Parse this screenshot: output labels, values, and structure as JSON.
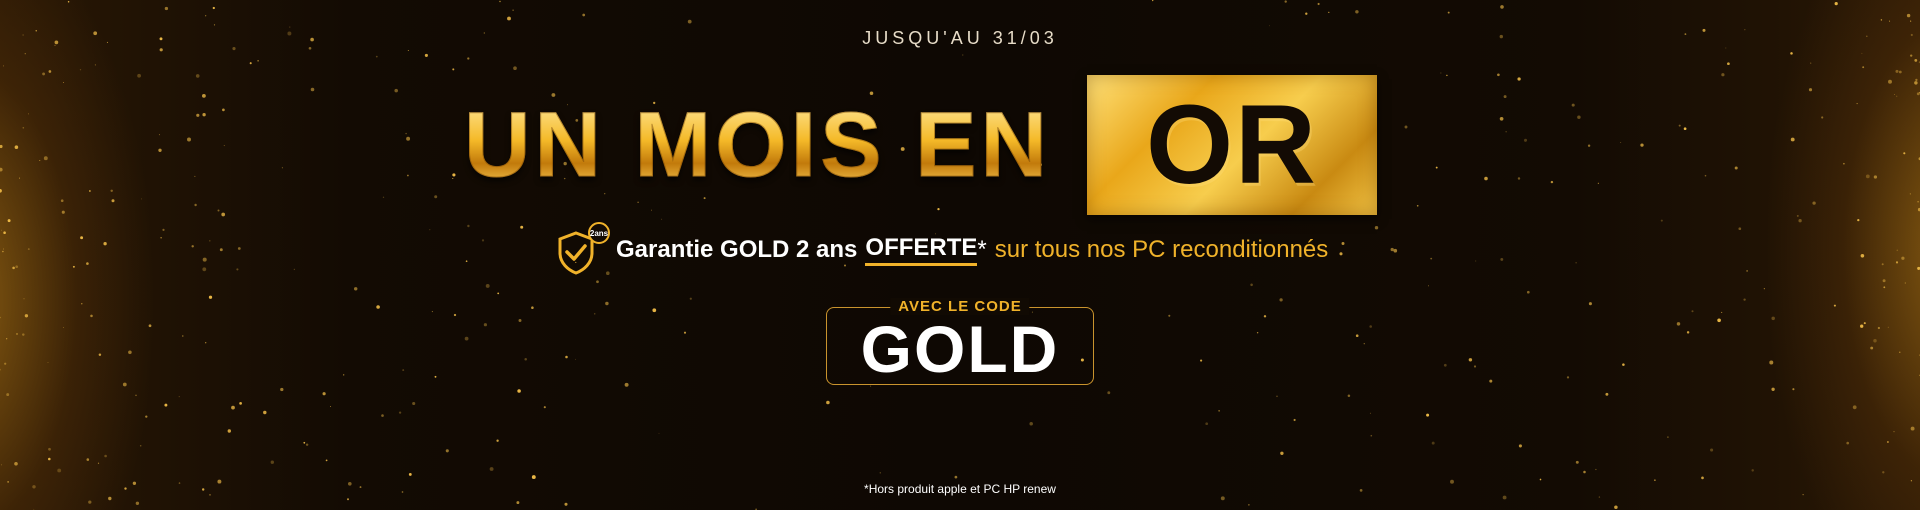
{
  "promo": {
    "date_line": "JUSQU'AU 31/03",
    "headline": "UN MOIS EN",
    "headline_highlight": "OR",
    "guarantee_bold": "Garantie GOLD 2 ans",
    "guarantee_offer": "OFFERTE",
    "guarantee_star": "*",
    "guarantee_rest": "sur tous nos PC reconditionnés",
    "shield_badge": "2ans",
    "code_label": "AVEC LE CODE",
    "code_value": "GOLD",
    "footnote": "*Hors produit apple et PC HP renew"
  },
  "icons": {
    "guarantee": "shield-check-icon"
  },
  "colors": {
    "gold": "#f0b22a",
    "gold_light": "#ffe27a",
    "background": "#140d05",
    "white": "#ffffff"
  }
}
